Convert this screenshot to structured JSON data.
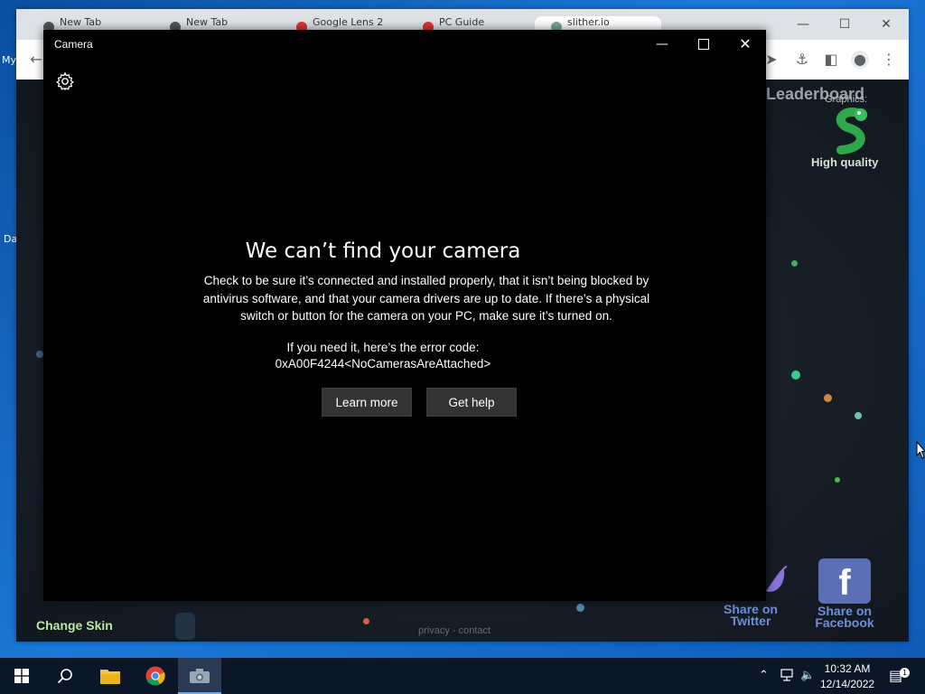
{
  "desktop": {
    "labels": [
      "My",
      "Da"
    ]
  },
  "browser": {
    "tabs": [
      {
        "label": "New Tab"
      },
      {
        "label": "New Tab"
      },
      {
        "label": "Google Lens 2"
      },
      {
        "label": "PC Guide"
      },
      {
        "label": "slither.io"
      }
    ],
    "page": {
      "leaderboard_title": "Leaderboard",
      "graphics_label": "Graphics:",
      "quality_label": "High quality",
      "change_skin": "Change Skin",
      "footer": "privacy - contact",
      "share_twitter": "Share on Twitter",
      "share_facebook": "Share on Facebook"
    }
  },
  "camera": {
    "title": "Camera",
    "error_title": "We can’t find your camera",
    "error_body": "Check to be sure it’s connected and installed properly, that it isn’t being blocked by antivirus software, and that your camera drivers are up to date. If there’s a physical switch or button for the camera on your PC, make sure it’s turned on.",
    "error_code_label": "If you need it, here’s the error code:",
    "error_code": "0xA00F4244<NoCamerasAreAttached>",
    "learn_more": "Learn more",
    "get_help": "Get help"
  },
  "taskbar": {
    "time": "10:32 AM",
    "date": "12/14/2022",
    "apps": [
      "windows-start",
      "search",
      "file-explorer",
      "chrome",
      "camera"
    ]
  }
}
